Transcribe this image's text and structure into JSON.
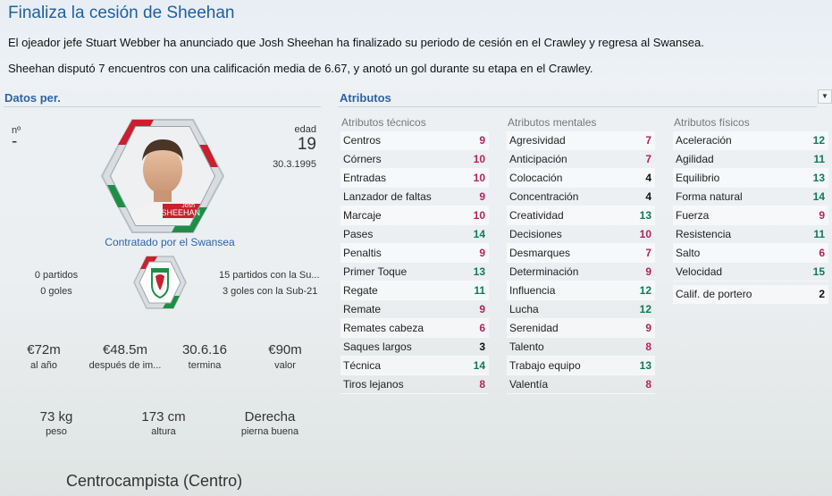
{
  "news": {
    "title": "Finaliza la cesión de Sheehan",
    "line1": "El ojeador jefe Stuart Webber ha anunciado que Josh Sheehan ha finalizado su periodo de cesión en el Crawley y regresa al Swansea.",
    "line2": "Sheehan disputó 7 encuentros con una calificación media de 6.67, y anotó un gol durante su etapa en el Crawley."
  },
  "personal": {
    "section_title": "Datos per.",
    "number_label": "nº",
    "number_value": "-",
    "age_label": "edad",
    "age_value": "19",
    "birth_date": "30.3.1995",
    "badge_first": "Josh",
    "badge_last": "SHEEHAN",
    "contract_link": "Contratado por el Swansea",
    "matches_label": "0 partidos",
    "goals_label": "0 goles",
    "u21_matches": "15 partidos con la Su...",
    "u21_goals": "3 goles con la Sub-21",
    "wage_value": "€72m",
    "wage_label": "al año",
    "tax_value": "€48.5m",
    "tax_label": "después de im...",
    "expiry_value": "30.6.16",
    "expiry_label": "termina",
    "worth_value": "€90m",
    "worth_label": "valor",
    "weight_value": "73 kg",
    "weight_label": "peso",
    "height_value": "173 cm",
    "height_label": "altura",
    "foot_value": "Derecha",
    "foot_label": "pierna buena",
    "position": "Centrocampista (Centro)"
  },
  "attributes": {
    "section_title": "Atributos",
    "technical": {
      "title": "Atributos técnicos",
      "rows": [
        {
          "name": "Centros",
          "value": "9",
          "color": "red"
        },
        {
          "name": "Córners",
          "value": "10",
          "color": "red"
        },
        {
          "name": "Entradas",
          "value": "10",
          "color": "red"
        },
        {
          "name": "Lanzador de faltas",
          "value": "9",
          "color": "red"
        },
        {
          "name": "Marcaje",
          "value": "10",
          "color": "red"
        },
        {
          "name": "Pases",
          "value": "14",
          "color": "green"
        },
        {
          "name": "Penaltis",
          "value": "9",
          "color": "red"
        },
        {
          "name": "Primer Toque",
          "value": "13",
          "color": "green"
        },
        {
          "name": "Regate",
          "value": "11",
          "color": "green"
        },
        {
          "name": "Remate",
          "value": "9",
          "color": "red"
        },
        {
          "name": "Remates cabeza",
          "value": "6",
          "color": "red"
        },
        {
          "name": "Saques largos",
          "value": "3",
          "color": "black"
        },
        {
          "name": "Técnica",
          "value": "14",
          "color": "green"
        },
        {
          "name": "Tiros lejanos",
          "value": "8",
          "color": "red"
        }
      ]
    },
    "mental": {
      "title": "Atributos mentales",
      "rows": [
        {
          "name": "Agresividad",
          "value": "7",
          "color": "red"
        },
        {
          "name": "Anticipación",
          "value": "7",
          "color": "red"
        },
        {
          "name": "Colocación",
          "value": "4",
          "color": "black"
        },
        {
          "name": "Concentración",
          "value": "4",
          "color": "black"
        },
        {
          "name": "Creatividad",
          "value": "13",
          "color": "green"
        },
        {
          "name": "Decisiones",
          "value": "10",
          "color": "red"
        },
        {
          "name": "Desmarques",
          "value": "7",
          "color": "red"
        },
        {
          "name": "Determinación",
          "value": "9",
          "color": "red"
        },
        {
          "name": "Influencia",
          "value": "12",
          "color": "green"
        },
        {
          "name": "Lucha",
          "value": "12",
          "color": "green"
        },
        {
          "name": "Serenidad",
          "value": "9",
          "color": "red"
        },
        {
          "name": "Talento",
          "value": "8",
          "color": "red"
        },
        {
          "name": "Trabajo equipo",
          "value": "13",
          "color": "green"
        },
        {
          "name": "Valentía",
          "value": "8",
          "color": "red"
        }
      ]
    },
    "physical": {
      "title": "Atributos físicos",
      "rows": [
        {
          "name": "Aceleración",
          "value": "12",
          "color": "green"
        },
        {
          "name": "Agilidad",
          "value": "11",
          "color": "green"
        },
        {
          "name": "Equilibrio",
          "value": "13",
          "color": "green"
        },
        {
          "name": "Forma natural",
          "value": "14",
          "color": "green"
        },
        {
          "name": "Fuerza",
          "value": "9",
          "color": "red"
        },
        {
          "name": "Resistencia",
          "value": "11",
          "color": "green"
        },
        {
          "name": "Salto",
          "value": "6",
          "color": "red"
        },
        {
          "name": "Velocidad",
          "value": "15",
          "color": "green"
        }
      ],
      "goalkeeper": {
        "name": "Calif. de portero",
        "value": "2",
        "color": "black"
      }
    }
  },
  "colors": {
    "red": "#b3245b",
    "green": "#0f7a55",
    "black": "#111111",
    "accent": "#1f5fa0"
  }
}
